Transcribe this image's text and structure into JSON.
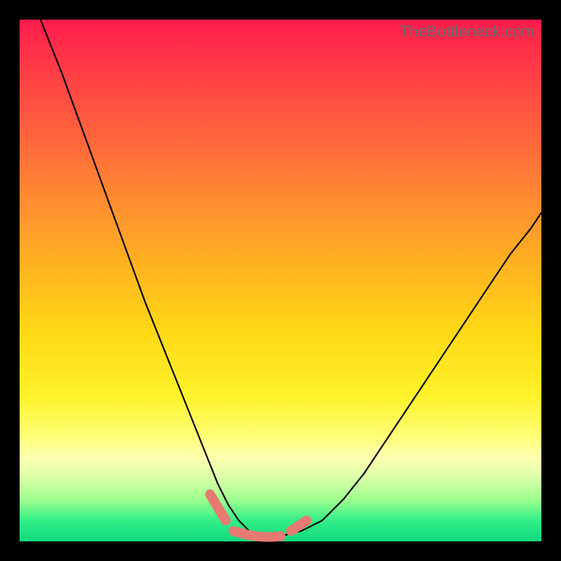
{
  "watermark": "TheBottleneck.com",
  "colors": {
    "page_bg": "#000000",
    "gradient_top": "#ff1a4d",
    "gradient_bottom": "#0ed97f",
    "curve_stroke": "#000000",
    "marker_fill": "#e77a72",
    "watermark_text": "#6b6b6b"
  },
  "chart_data": {
    "type": "line",
    "title": "",
    "xlabel": "",
    "ylabel": "",
    "xlim": [
      0,
      100
    ],
    "ylim": [
      0,
      100
    ],
    "grid": false,
    "legend": false,
    "annotations": [
      "TheBottleneck.com"
    ],
    "note": "background is a vertical red→yellow→green gradient; a single black V-shaped curve with pink marker segments near the trough",
    "series": [
      {
        "name": "curve",
        "x": [
          4,
          8,
          12,
          16,
          20,
          24,
          28,
          32,
          36,
          38,
          40,
          42,
          44,
          46,
          48,
          50,
          54,
          58,
          62,
          66,
          70,
          74,
          78,
          82,
          86,
          90,
          94,
          98,
          100
        ],
        "y": [
          100,
          90,
          79,
          68,
          57,
          46,
          36,
          26,
          16,
          11,
          7,
          4,
          2,
          1,
          1,
          1,
          2,
          4,
          8,
          13,
          19,
          25,
          31,
          37,
          43,
          49,
          55,
          60,
          63
        ]
      }
    ],
    "markers": [
      {
        "name": "left-cap",
        "x_range": [
          36.5,
          39.5
        ],
        "y_range": [
          9,
          4
        ]
      },
      {
        "name": "trough",
        "x_range": [
          41,
          50
        ],
        "y_range": [
          2,
          1
        ]
      },
      {
        "name": "right-cap",
        "x_range": [
          52,
          55
        ],
        "y_range": [
          2,
          4
        ]
      }
    ]
  }
}
